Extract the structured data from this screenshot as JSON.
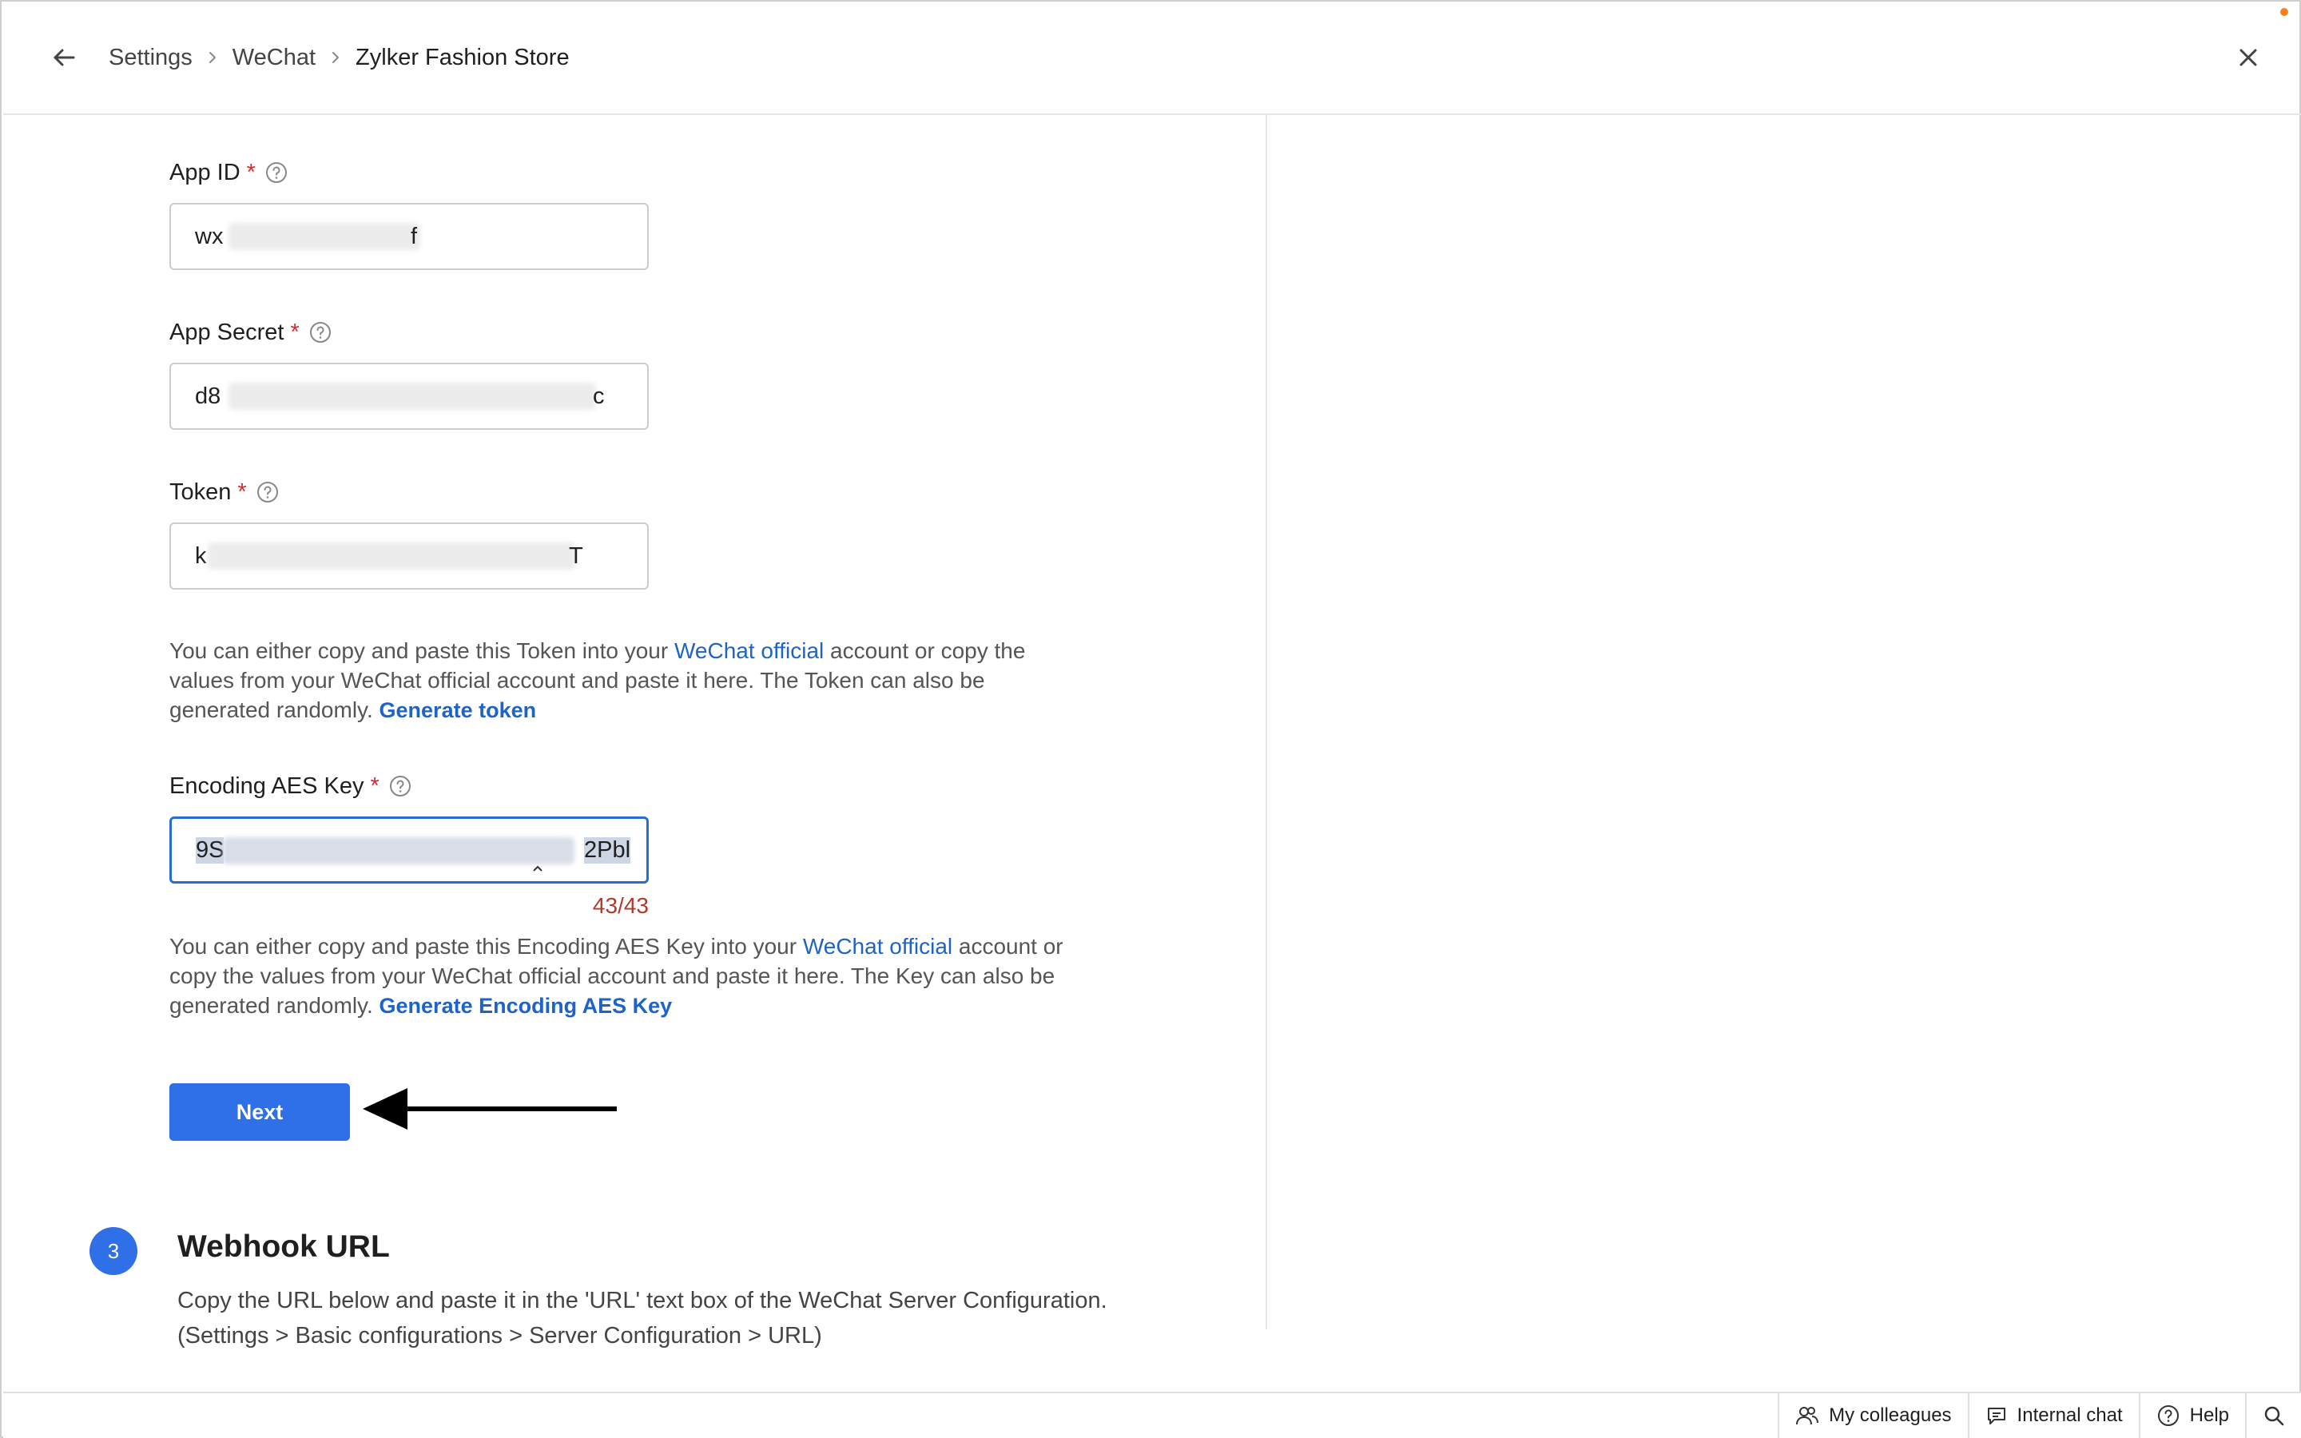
{
  "header": {
    "breadcrumb": [
      "Settings",
      "WeChat",
      "Zylker Fashion Store"
    ]
  },
  "form": {
    "app_id": {
      "label": "App ID",
      "required_mark": "*",
      "value_start": "wx",
      "value_end": "f"
    },
    "app_secret": {
      "label": "App Secret",
      "required_mark": "*",
      "value_start": "d8",
      "value_end": "c"
    },
    "token": {
      "label": "Token",
      "required_mark": "*",
      "value_start": "k",
      "value_end": "T"
    },
    "token_help": {
      "text_before": "You can either copy and paste this Token into your ",
      "link": "WeChat official",
      "text_after": " account or copy the values from your WeChat official account and paste it here. The Token can also be generated randomly. ",
      "action": "Generate token"
    },
    "aes_key": {
      "label": "Encoding AES Key",
      "required_mark": "*",
      "value_start": "9S",
      "value_end": "2Pbl",
      "counter": "43/43"
    },
    "aes_help": {
      "text_before": "You can either copy and paste this Encoding AES Key into your ",
      "link": "WeChat official",
      "text_after": " account or copy the values from your WeChat official account and paste it here. The Key can also be generated randomly. ",
      "action": "Generate Encoding AES Key"
    },
    "next_label": "Next"
  },
  "step3": {
    "number": "3",
    "title": "Webhook URL",
    "line1": "Copy the URL below and paste it in the 'URL' text box of the WeChat Server Configuration.",
    "line2": "(Settings > Basic configurations > Server Configuration > URL)"
  },
  "bottombar": {
    "colleagues": "My colleagues",
    "internal_chat": "Internal chat",
    "help": "Help"
  },
  "colors": {
    "accent": "#2f6fe8",
    "link": "#1e63c8",
    "required": "#e0262c",
    "counter": "#b03a2e",
    "notification": "#f5821f"
  },
  "icons": [
    "back-arrow-icon",
    "chevron-right-icon",
    "close-icon",
    "help-circle-icon",
    "people-icon",
    "chat-icon",
    "question-icon",
    "search-icon"
  ]
}
